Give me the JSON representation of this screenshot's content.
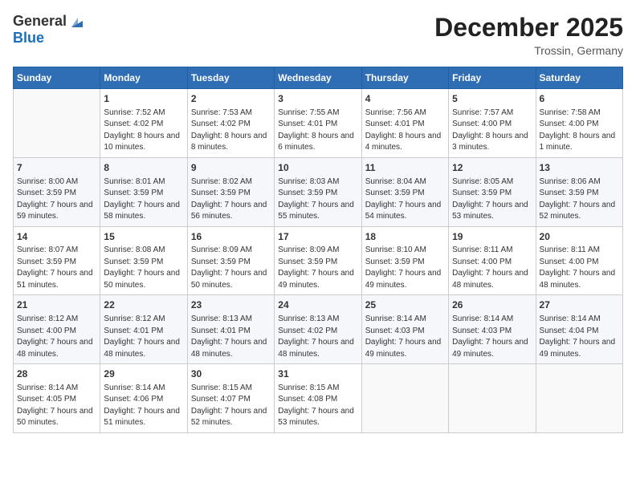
{
  "header": {
    "logo_general": "General",
    "logo_blue": "Blue",
    "month_title": "December 2025",
    "location": "Trossin, Germany"
  },
  "days_of_week": [
    "Sunday",
    "Monday",
    "Tuesday",
    "Wednesday",
    "Thursday",
    "Friday",
    "Saturday"
  ],
  "weeks": [
    [
      {
        "day": "",
        "sunrise": "",
        "sunset": "",
        "daylight": "",
        "empty": true
      },
      {
        "day": "1",
        "sunrise": "Sunrise: 7:52 AM",
        "sunset": "Sunset: 4:02 PM",
        "daylight": "Daylight: 8 hours and 10 minutes.",
        "empty": false
      },
      {
        "day": "2",
        "sunrise": "Sunrise: 7:53 AM",
        "sunset": "Sunset: 4:02 PM",
        "daylight": "Daylight: 8 hours and 8 minutes.",
        "empty": false
      },
      {
        "day": "3",
        "sunrise": "Sunrise: 7:55 AM",
        "sunset": "Sunset: 4:01 PM",
        "daylight": "Daylight: 8 hours and 6 minutes.",
        "empty": false
      },
      {
        "day": "4",
        "sunrise": "Sunrise: 7:56 AM",
        "sunset": "Sunset: 4:01 PM",
        "daylight": "Daylight: 8 hours and 4 minutes.",
        "empty": false
      },
      {
        "day": "5",
        "sunrise": "Sunrise: 7:57 AM",
        "sunset": "Sunset: 4:00 PM",
        "daylight": "Daylight: 8 hours and 3 minutes.",
        "empty": false
      },
      {
        "day": "6",
        "sunrise": "Sunrise: 7:58 AM",
        "sunset": "Sunset: 4:00 PM",
        "daylight": "Daylight: 8 hours and 1 minute.",
        "empty": false
      }
    ],
    [
      {
        "day": "7",
        "sunrise": "Sunrise: 8:00 AM",
        "sunset": "Sunset: 3:59 PM",
        "daylight": "Daylight: 7 hours and 59 minutes.",
        "empty": false
      },
      {
        "day": "8",
        "sunrise": "Sunrise: 8:01 AM",
        "sunset": "Sunset: 3:59 PM",
        "daylight": "Daylight: 7 hours and 58 minutes.",
        "empty": false
      },
      {
        "day": "9",
        "sunrise": "Sunrise: 8:02 AM",
        "sunset": "Sunset: 3:59 PM",
        "daylight": "Daylight: 7 hours and 56 minutes.",
        "empty": false
      },
      {
        "day": "10",
        "sunrise": "Sunrise: 8:03 AM",
        "sunset": "Sunset: 3:59 PM",
        "daylight": "Daylight: 7 hours and 55 minutes.",
        "empty": false
      },
      {
        "day": "11",
        "sunrise": "Sunrise: 8:04 AM",
        "sunset": "Sunset: 3:59 PM",
        "daylight": "Daylight: 7 hours and 54 minutes.",
        "empty": false
      },
      {
        "day": "12",
        "sunrise": "Sunrise: 8:05 AM",
        "sunset": "Sunset: 3:59 PM",
        "daylight": "Daylight: 7 hours and 53 minutes.",
        "empty": false
      },
      {
        "day": "13",
        "sunrise": "Sunrise: 8:06 AM",
        "sunset": "Sunset: 3:59 PM",
        "daylight": "Daylight: 7 hours and 52 minutes.",
        "empty": false
      }
    ],
    [
      {
        "day": "14",
        "sunrise": "Sunrise: 8:07 AM",
        "sunset": "Sunset: 3:59 PM",
        "daylight": "Daylight: 7 hours and 51 minutes.",
        "empty": false
      },
      {
        "day": "15",
        "sunrise": "Sunrise: 8:08 AM",
        "sunset": "Sunset: 3:59 PM",
        "daylight": "Daylight: 7 hours and 50 minutes.",
        "empty": false
      },
      {
        "day": "16",
        "sunrise": "Sunrise: 8:09 AM",
        "sunset": "Sunset: 3:59 PM",
        "daylight": "Daylight: 7 hours and 50 minutes.",
        "empty": false
      },
      {
        "day": "17",
        "sunrise": "Sunrise: 8:09 AM",
        "sunset": "Sunset: 3:59 PM",
        "daylight": "Daylight: 7 hours and 49 minutes.",
        "empty": false
      },
      {
        "day": "18",
        "sunrise": "Sunrise: 8:10 AM",
        "sunset": "Sunset: 3:59 PM",
        "daylight": "Daylight: 7 hours and 49 minutes.",
        "empty": false
      },
      {
        "day": "19",
        "sunrise": "Sunrise: 8:11 AM",
        "sunset": "Sunset: 4:00 PM",
        "daylight": "Daylight: 7 hours and 48 minutes.",
        "empty": false
      },
      {
        "day": "20",
        "sunrise": "Sunrise: 8:11 AM",
        "sunset": "Sunset: 4:00 PM",
        "daylight": "Daylight: 7 hours and 48 minutes.",
        "empty": false
      }
    ],
    [
      {
        "day": "21",
        "sunrise": "Sunrise: 8:12 AM",
        "sunset": "Sunset: 4:00 PM",
        "daylight": "Daylight: 7 hours and 48 minutes.",
        "empty": false
      },
      {
        "day": "22",
        "sunrise": "Sunrise: 8:12 AM",
        "sunset": "Sunset: 4:01 PM",
        "daylight": "Daylight: 7 hours and 48 minutes.",
        "empty": false
      },
      {
        "day": "23",
        "sunrise": "Sunrise: 8:13 AM",
        "sunset": "Sunset: 4:01 PM",
        "daylight": "Daylight: 7 hours and 48 minutes.",
        "empty": false
      },
      {
        "day": "24",
        "sunrise": "Sunrise: 8:13 AM",
        "sunset": "Sunset: 4:02 PM",
        "daylight": "Daylight: 7 hours and 48 minutes.",
        "empty": false
      },
      {
        "day": "25",
        "sunrise": "Sunrise: 8:14 AM",
        "sunset": "Sunset: 4:03 PM",
        "daylight": "Daylight: 7 hours and 49 minutes.",
        "empty": false
      },
      {
        "day": "26",
        "sunrise": "Sunrise: 8:14 AM",
        "sunset": "Sunset: 4:03 PM",
        "daylight": "Daylight: 7 hours and 49 minutes.",
        "empty": false
      },
      {
        "day": "27",
        "sunrise": "Sunrise: 8:14 AM",
        "sunset": "Sunset: 4:04 PM",
        "daylight": "Daylight: 7 hours and 49 minutes.",
        "empty": false
      }
    ],
    [
      {
        "day": "28",
        "sunrise": "Sunrise: 8:14 AM",
        "sunset": "Sunset: 4:05 PM",
        "daylight": "Daylight: 7 hours and 50 minutes.",
        "empty": false
      },
      {
        "day": "29",
        "sunrise": "Sunrise: 8:14 AM",
        "sunset": "Sunset: 4:06 PM",
        "daylight": "Daylight: 7 hours and 51 minutes.",
        "empty": false
      },
      {
        "day": "30",
        "sunrise": "Sunrise: 8:15 AM",
        "sunset": "Sunset: 4:07 PM",
        "daylight": "Daylight: 7 hours and 52 minutes.",
        "empty": false
      },
      {
        "day": "31",
        "sunrise": "Sunrise: 8:15 AM",
        "sunset": "Sunset: 4:08 PM",
        "daylight": "Daylight: 7 hours and 53 minutes.",
        "empty": false
      },
      {
        "day": "",
        "sunrise": "",
        "sunset": "",
        "daylight": "",
        "empty": true
      },
      {
        "day": "",
        "sunrise": "",
        "sunset": "",
        "daylight": "",
        "empty": true
      },
      {
        "day": "",
        "sunrise": "",
        "sunset": "",
        "daylight": "",
        "empty": true
      }
    ]
  ]
}
